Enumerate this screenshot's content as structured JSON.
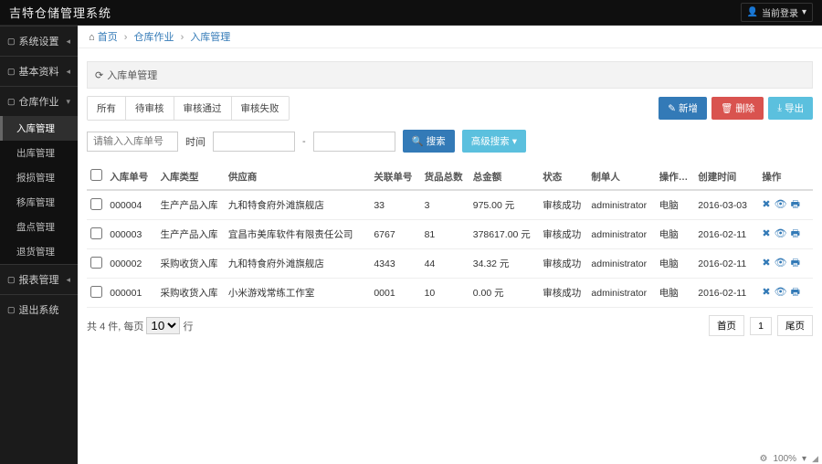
{
  "app": {
    "title": "吉特仓储管理系统"
  },
  "user": {
    "label": "当前登录",
    "caret": "▾"
  },
  "sidebar": {
    "collapse_glyph": "‹",
    "groups": [
      {
        "label": "系统设置",
        "caret": "◂",
        "sub": []
      },
      {
        "label": "基本资料",
        "caret": "◂",
        "sub": []
      },
      {
        "label": "仓库作业",
        "caret": "▾",
        "sub": [
          {
            "label": "入库管理",
            "active": true
          },
          {
            "label": "出库管理"
          },
          {
            "label": "报损管理"
          },
          {
            "label": "移库管理"
          },
          {
            "label": "盘点管理"
          },
          {
            "label": "退货管理"
          }
        ]
      },
      {
        "label": "报表管理",
        "caret": "◂",
        "sub": []
      },
      {
        "label": "退出系统",
        "caret": "",
        "sub": []
      }
    ]
  },
  "breadcrumb": {
    "home_icon": "⌂",
    "home": "首页",
    "items": [
      "仓库作业",
      "入库管理"
    ]
  },
  "panel": {
    "icon": "⟳",
    "title": "入库单管理"
  },
  "tabs": [
    "所有",
    "待审核",
    "审核通过",
    "审核失败"
  ],
  "buttons": {
    "new": "新增",
    "delete": "删除",
    "export": "导出",
    "search": "搜索",
    "adv": "高级搜索"
  },
  "button_icons": {
    "new": "✎",
    "delete": "🗑",
    "export": "⤓",
    "search": "🔍",
    "adv_caret": "▾"
  },
  "filter": {
    "order_ph": "请输入入库单号",
    "time_label": "时间"
  },
  "columns": [
    "入库单号",
    "入库类型",
    "供应商",
    "关联单号",
    "货品总数",
    "总金额",
    "状态",
    "制单人",
    "操作方式",
    "创建时间",
    "操作"
  ],
  "rows": [
    {
      "no": "000004",
      "type": "生产产品入库",
      "supplier": "九和特食府外滩旗舰店",
      "rel": "33",
      "qty": "3",
      "amt": "975.00 元",
      "status": "审核成功",
      "maker": "administrator",
      "mode": "电脑",
      "created": "2016-03-03"
    },
    {
      "no": "000003",
      "type": "生产产品入库",
      "supplier": "宜昌市美库软件有限责任公司",
      "rel": "6767",
      "qty": "81",
      "amt": "378617.00 元",
      "status": "审核成功",
      "maker": "administrator",
      "mode": "电脑",
      "created": "2016-02-11"
    },
    {
      "no": "000002",
      "type": "采购收货入库",
      "supplier": "九和特食府外滩旗舰店",
      "rel": "4343",
      "qty": "44",
      "amt": "34.32 元",
      "status": "审核成功",
      "maker": "administrator",
      "mode": "电脑",
      "created": "2016-02-11"
    },
    {
      "no": "000001",
      "type": "采购收货入库",
      "supplier": "小米游戏常练工作室",
      "rel": "0001",
      "qty": "10",
      "amt": "0.00 元",
      "status": "审核成功",
      "maker": "administrator",
      "mode": "电脑",
      "created": "2016-02-11"
    }
  ],
  "row_ops": {
    "del": "✖",
    "view": "👁",
    "print": "🖶"
  },
  "pager": {
    "total_tpl_prefix": "共 ",
    "total_tpl_mid": " 件, 每页 ",
    "total_tpl_suffix": " 行",
    "total": "4",
    "page_sizes": [
      "10"
    ],
    "first": "首页",
    "page": "1",
    "last": "尾页"
  },
  "footer": {
    "zoom": "100%"
  }
}
